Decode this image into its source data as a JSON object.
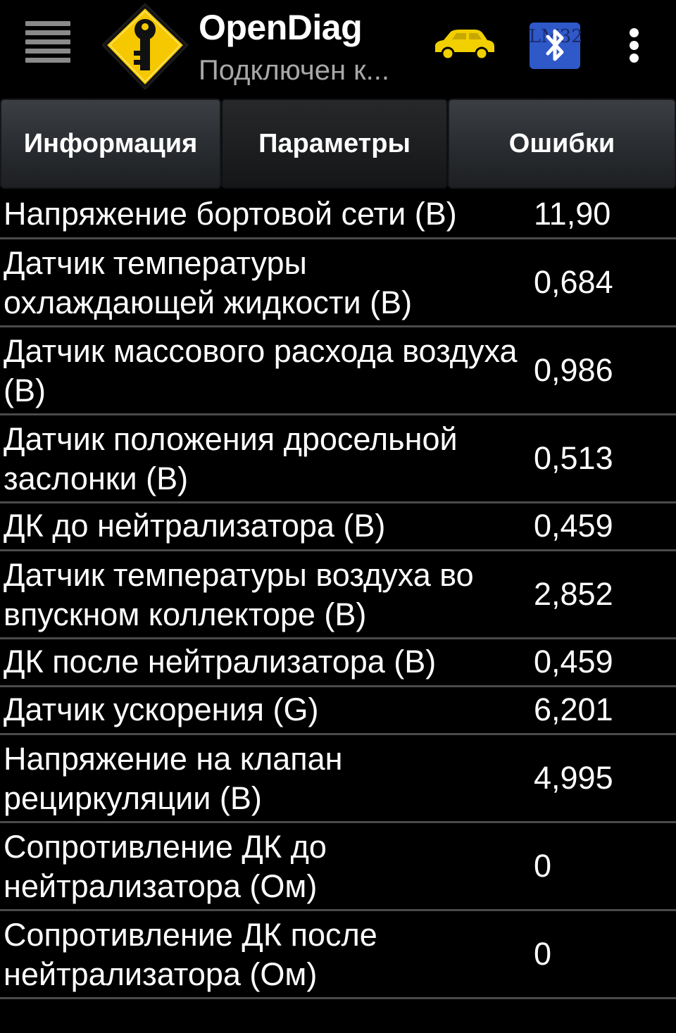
{
  "actionbar": {
    "title": "OpenDiag",
    "subtitle": "Подключен к...",
    "menu_icon": "hamburger-menu-icon",
    "logo_icon": "yellow-diamond-key-icon",
    "car_icon": "car-icon",
    "bluetooth_icon": "bluetooth-elm327-icon",
    "bluetooth_icon_text": "ELM327",
    "overflow_icon": "overflow-menu-icon",
    "colors": {
      "logo_yellow": "#f5c800",
      "car_yellow": "#f2d000",
      "bluetooth_blue": "#2f58c8"
    }
  },
  "tabs": [
    {
      "label": "Информация",
      "active": false
    },
    {
      "label": "Параметры",
      "active": true
    },
    {
      "label": "Ошибки",
      "active": false
    }
  ],
  "parameters": [
    {
      "name": "Напряжение бортовой сети (В)",
      "value": "11,90"
    },
    {
      "name": "Датчик температуры охлаждающей жидкости (В)",
      "value": "0,684"
    },
    {
      "name": "Датчик массового расхода воздуха (В)",
      "value": "0,986"
    },
    {
      "name": "Датчик положения дросельной заслонки (В)",
      "value": "0,513"
    },
    {
      "name": "ДК до нейтрализатора (В)",
      "value": "0,459"
    },
    {
      "name": "Датчик температуры воздуха во впускном коллекторе (В)",
      "value": "2,852"
    },
    {
      "name": "ДК после нейтрализатора (В)",
      "value": "0,459"
    },
    {
      "name": "Датчик ускорения (G)",
      "value": "6,201"
    },
    {
      "name": "Напряжение на клапан рециркуляции (В)",
      "value": "4,995"
    },
    {
      "name": "Сопротивление ДК до нейтрализатора (Ом)",
      "value": "0"
    },
    {
      "name": "Сопротивление ДК после нейтрализатора (Ом)",
      "value": "0"
    }
  ]
}
